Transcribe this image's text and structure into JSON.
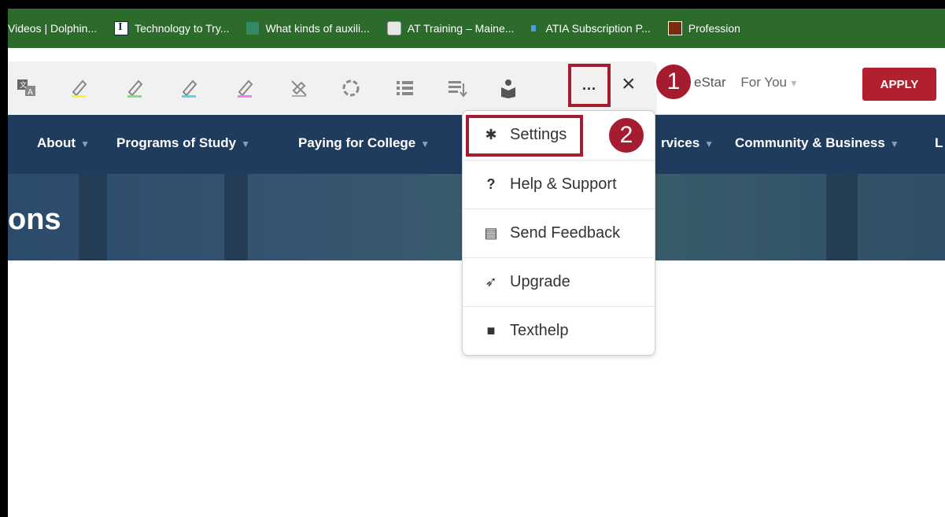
{
  "bookmarks": [
    {
      "icon": "play-icon",
      "label": "Videos | Dolphin..."
    },
    {
      "icon": "illini-logo-icon",
      "label": "Technology to Try..."
    },
    {
      "icon": "books-icon",
      "label": "What kinds of auxili..."
    },
    {
      "icon": "training-icon",
      "label": "AT Training – Maine..."
    },
    {
      "icon": "atia-icon",
      "label": "ATIA Subscription P..."
    },
    {
      "icon": "profession-icon",
      "label": "Profession"
    }
  ],
  "header": {
    "partial_text": "eStar",
    "for_you": "For You",
    "apply": "APPLY"
  },
  "toolbar": {
    "more_label": "...",
    "close_label": "×"
  },
  "callouts": {
    "one": "1",
    "two": "2"
  },
  "nav": {
    "items": [
      "About",
      "Programs of Study",
      "Paying for College",
      "rvices",
      "Community & Business",
      "L"
    ]
  },
  "hero": {
    "title_fragment": "ons"
  },
  "menu": {
    "items": [
      {
        "icon": "gear-icon",
        "label": "Settings"
      },
      {
        "icon": "question-icon",
        "label": "Help & Support"
      },
      {
        "icon": "feedback-icon",
        "label": "Send Feedback"
      },
      {
        "icon": "rocket-icon",
        "label": "Upgrade"
      },
      {
        "icon": "texthelp-icon",
        "label": "Texthelp"
      }
    ]
  },
  "colors": {
    "bookmark_bar": "#2d6b2d",
    "nav_bg": "#1f3c5e",
    "callout_red": "#a51c30",
    "apply_red": "#b21f2d"
  }
}
